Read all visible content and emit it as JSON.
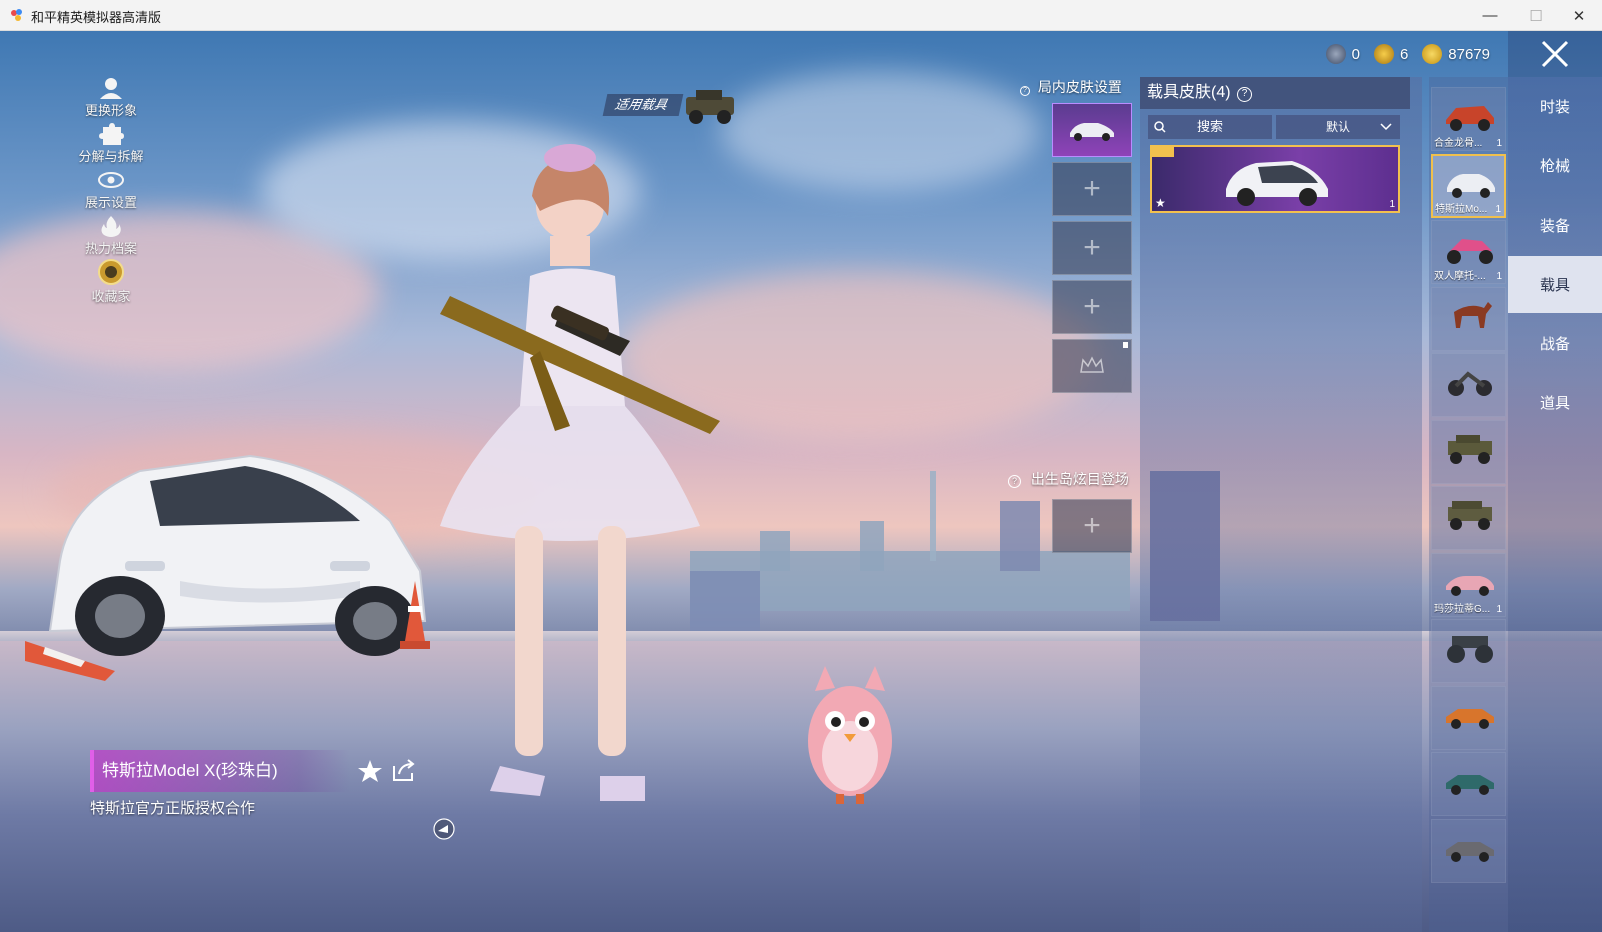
{
  "window": {
    "title": "和平精英模拟器高清版",
    "minimize": "—",
    "maximize": "☐",
    "close": "✕"
  },
  "left_menu": [
    {
      "label": "更换形象",
      "icon": "person-icon"
    },
    {
      "label": "分解与拆解",
      "icon": "puzzle-icon"
    },
    {
      "label": "展示设置",
      "icon": "eye-icon"
    },
    {
      "label": "热力档案",
      "icon": "flame-icon"
    },
    {
      "label": "收藏家",
      "icon": "collector-badge-icon"
    }
  ],
  "use_vehicle_label": "适用载具",
  "currency": [
    {
      "icon": "globe-coin-icon",
      "value": "0"
    },
    {
      "icon": "gold-a-coin-icon",
      "value": "6"
    },
    {
      "icon": "gold-coin-icon",
      "value": "87679"
    }
  ],
  "right_nav": {
    "close_icon": "close-icon",
    "tabs": [
      "时装",
      "枪械",
      "装备",
      "载具",
      "战备",
      "道具"
    ],
    "active_tab": "载具"
  },
  "slots": {
    "header": "局内皮肤设置",
    "spawn_header": "出生岛炫目登场",
    "plus": "+"
  },
  "skin_panel": {
    "title": "载具皮肤(4)",
    "search_label": "搜索",
    "sort_label": "默认",
    "selected_card_count": "1"
  },
  "vehicle_list": [
    {
      "name": "合金龙骨...",
      "count": "1",
      "color": "#c8442a"
    },
    {
      "name": "特斯拉Mo...",
      "count": "1",
      "color": "#e8e8ee",
      "selected": true
    },
    {
      "name": "双人摩托-...",
      "count": "1",
      "color": "#e0508a"
    },
    {
      "name": "",
      "count": "",
      "color": "#8a3a22"
    },
    {
      "name": "",
      "count": "",
      "color": "#2b2b30"
    },
    {
      "name": "",
      "count": "",
      "color": "#5b5a3b"
    },
    {
      "name": "",
      "count": "",
      "color": "#5e5c40"
    },
    {
      "name": "玛莎拉蒂G...",
      "count": "1",
      "color": "#e8a6b4"
    },
    {
      "name": "",
      "count": "",
      "color": "#2d3238"
    },
    {
      "name": "",
      "count": "",
      "color": "#d8752c"
    },
    {
      "name": "",
      "count": "",
      "color": "#2f6a6a"
    },
    {
      "name": "",
      "count": "",
      "color": "#6a6a70"
    }
  ],
  "item_info": {
    "name": "特斯拉Model X(珍珠白)",
    "description": "特斯拉官方正版授权合作"
  }
}
